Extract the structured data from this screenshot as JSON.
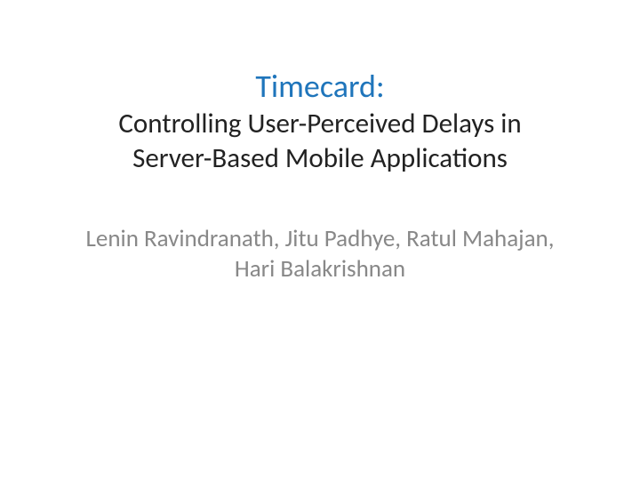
{
  "title": {
    "main": "Timecard",
    "colon": ":",
    "subtitle_line1": "Controlling User-Perceived Delays in",
    "subtitle_line2": "Server-Based Mobile Applications"
  },
  "authors": {
    "line1": "Lenin Ravindranath, Jitu Padhye, Ratul Mahajan,",
    "line2": "Hari Balakrishnan"
  }
}
